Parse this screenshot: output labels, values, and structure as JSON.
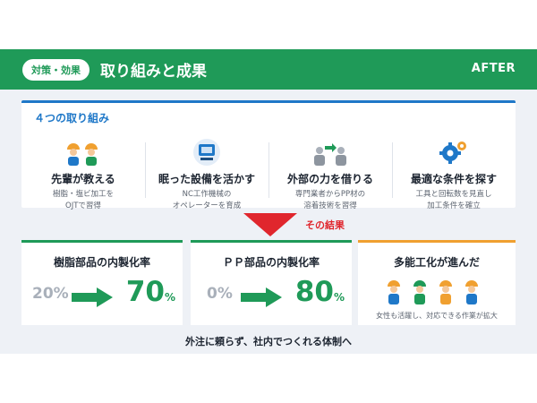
{
  "header": {
    "tag": "対策・効果",
    "title": "取り組みと成果",
    "right": "AFTER"
  },
  "efforts": {
    "title": "４つの取り組み",
    "items": [
      {
        "icon": "people-icon",
        "title": "先輩が教える",
        "desc1": "樹脂・塩ビ加工を",
        "desc2": "OJTで習得"
      },
      {
        "icon": "machine-icon",
        "title": "眠った設備を活かす",
        "desc1": "NC工作機械の",
        "desc2": "オペレーターを育成"
      },
      {
        "icon": "collaboration-icon",
        "title": "外部の力を借りる",
        "desc1": "専門業者からPP材の",
        "desc2": "溶着技術を習得"
      },
      {
        "icon": "gears-icon",
        "title": "最適な条件を探す",
        "desc1": "工具と回転数を見直し",
        "desc2": "加工条件を確立"
      }
    ]
  },
  "result_label": "その結果",
  "results": [
    {
      "title": "樹脂部品の内製化率",
      "before": "20%",
      "after": "70",
      "unit": "%"
    },
    {
      "title": "ＰＰ部品の内製化率",
      "before": "0%",
      "after": "80",
      "unit": "%"
    },
    {
      "title": "多能工化が進んだ",
      "caption": "女性も活躍し、対応できる作業が拡大"
    }
  ],
  "footer": "外注に頼らず、社内でつくれる体制へ",
  "colors": {
    "green": "#1f9a58",
    "blue": "#1f78c8",
    "red": "#e0262d",
    "orange": "#f0a030"
  }
}
